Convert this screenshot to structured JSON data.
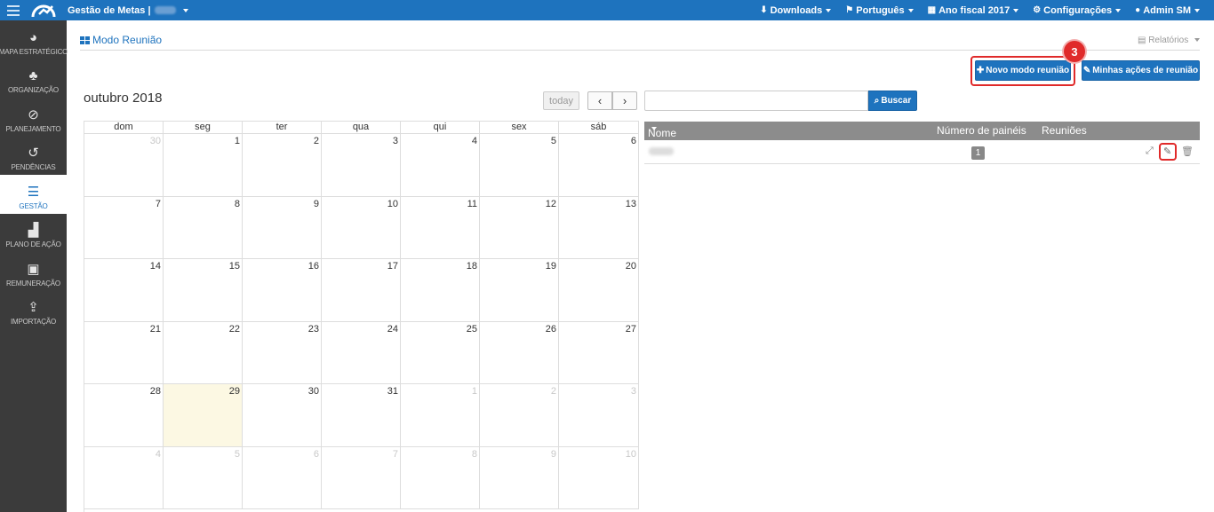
{
  "topbar": {
    "app_title": "Gestão de Metas |",
    "downloads": "Downloads",
    "language": "Português",
    "fiscal_year": "Ano fiscal 2017",
    "settings": "Configurações",
    "user": "Admin SM"
  },
  "sidebar": {
    "items": [
      {
        "label": "MAPA ESTRATÉGICO",
        "icon": "pie-chart-icon"
      },
      {
        "label": "ORGANIZAÇÃO",
        "icon": "org-chart-icon"
      },
      {
        "label": "PLANEJAMENTO",
        "icon": "compass-icon"
      },
      {
        "label": "PENDÊNCIAS",
        "icon": "history-icon"
      },
      {
        "label": "GESTÃO",
        "icon": "layers-icon",
        "active": true
      },
      {
        "label": "PLANO DE AÇÃO",
        "icon": "bar-chart-icon"
      },
      {
        "label": "REMUNERAÇÃO",
        "icon": "money-icon"
      },
      {
        "label": "IMPORTAÇÃO",
        "icon": "import-icon"
      }
    ]
  },
  "page": {
    "title": "Modo Reunião",
    "reports": "Relatórios"
  },
  "actions": {
    "new_meeting_mode": "Novo modo reunião",
    "my_meeting_actions": "Minhas ações de reunião",
    "step_number": "3"
  },
  "calendar": {
    "title": "outubro 2018",
    "today_label": "today",
    "weekdays": [
      "dom",
      "seg",
      "ter",
      "qua",
      "qui",
      "sex",
      "sáb"
    ],
    "weeks": [
      [
        {
          "d": "30",
          "o": true
        },
        {
          "d": "1"
        },
        {
          "d": "2"
        },
        {
          "d": "3"
        },
        {
          "d": "4"
        },
        {
          "d": "5"
        },
        {
          "d": "6"
        }
      ],
      [
        {
          "d": "7"
        },
        {
          "d": "8"
        },
        {
          "d": "9"
        },
        {
          "d": "10"
        },
        {
          "d": "11"
        },
        {
          "d": "12"
        },
        {
          "d": "13"
        }
      ],
      [
        {
          "d": "14"
        },
        {
          "d": "15"
        },
        {
          "d": "16"
        },
        {
          "d": "17"
        },
        {
          "d": "18"
        },
        {
          "d": "19"
        },
        {
          "d": "20"
        }
      ],
      [
        {
          "d": "21"
        },
        {
          "d": "22"
        },
        {
          "d": "23"
        },
        {
          "d": "24"
        },
        {
          "d": "25"
        },
        {
          "d": "26"
        },
        {
          "d": "27"
        }
      ],
      [
        {
          "d": "28"
        },
        {
          "d": "29",
          "t": true
        },
        {
          "d": "30"
        },
        {
          "d": "31"
        },
        {
          "d": "1",
          "o": true
        },
        {
          "d": "2",
          "o": true
        },
        {
          "d": "3",
          "o": true
        }
      ],
      [
        {
          "d": "4",
          "o": true
        },
        {
          "d": "5",
          "o": true
        },
        {
          "d": "6",
          "o": true
        },
        {
          "d": "7",
          "o": true
        },
        {
          "d": "8",
          "o": true
        },
        {
          "d": "9",
          "o": true
        },
        {
          "d": "10",
          "o": true
        }
      ]
    ]
  },
  "search": {
    "value": "",
    "placeholder": "",
    "button": "Buscar"
  },
  "table": {
    "headers": {
      "name": "Nome",
      "panels": "Número de painéis",
      "meetings": "Reuniões"
    },
    "rows": [
      {
        "panels": "1"
      }
    ]
  },
  "colors": {
    "primary": "#1e73be",
    "sidebar": "#3b3b3b",
    "highlight": "#e02a2a",
    "today_bg": "#fcf8e3"
  }
}
